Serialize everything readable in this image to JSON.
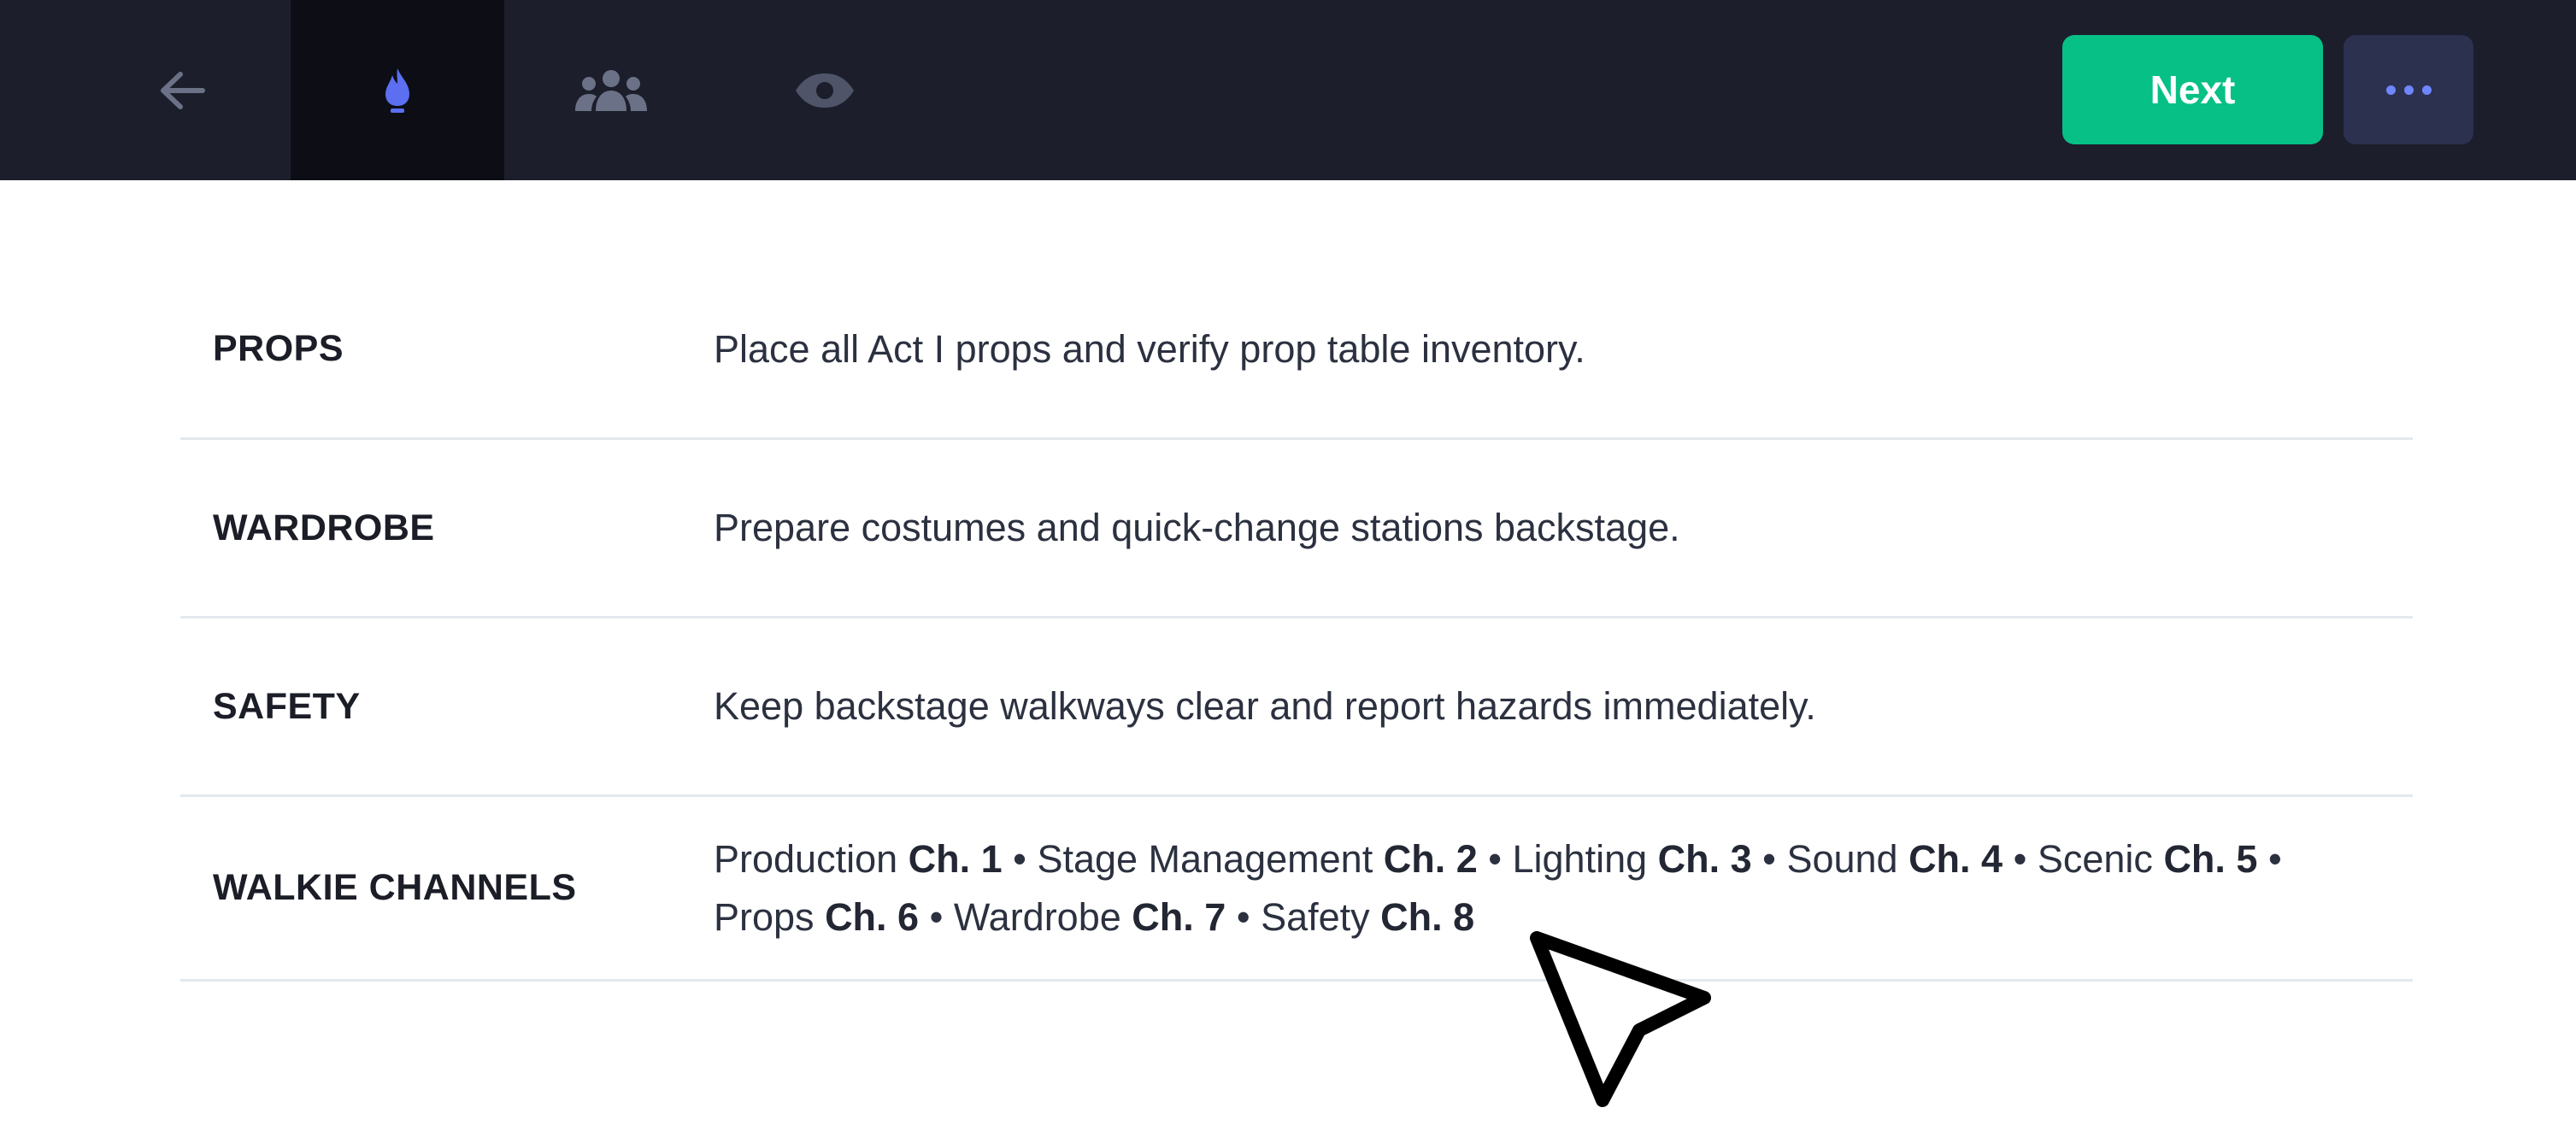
{
  "toolbar": {
    "tabs": [
      {
        "name": "back",
        "icon": "arrow-left-icon",
        "active": false
      },
      {
        "name": "fire",
        "icon": "flame-icon",
        "active": true
      },
      {
        "name": "team",
        "icon": "users-icon",
        "active": false
      },
      {
        "name": "view",
        "icon": "eye-icon",
        "active": false
      }
    ],
    "next_label": "Next",
    "more_icon": "ellipsis-icon"
  },
  "rows": [
    {
      "label": "PROPS",
      "description": "Place all Act I props and verify prop table inventory."
    },
    {
      "label": "WARDROBE",
      "description": "Prepare costumes and quick-change stations backstage."
    },
    {
      "label": "SAFETY",
      "description": "Keep backstage walkways clear and report hazards immediately."
    }
  ],
  "walkie": {
    "label": "WALKIE CHANNELS",
    "channels": [
      {
        "dept": "Production",
        "channel": "Ch. 1"
      },
      {
        "dept": "Stage Management",
        "channel": "Ch. 2"
      },
      {
        "dept": "Lighting",
        "channel": "Ch. 3"
      },
      {
        "dept": "Sound",
        "channel": "Ch. 4"
      },
      {
        "dept": "Scenic",
        "channel": "Ch. 5"
      },
      {
        "dept": "Props",
        "channel": "Ch. 6"
      },
      {
        "dept": "Wardrobe",
        "channel": "Ch. 7"
      },
      {
        "dept": "Safety",
        "channel": "Ch. 8"
      }
    ],
    "separator": " • "
  },
  "colors": {
    "topbar": "#1c1e2b",
    "active_tab": "#0d0e15",
    "next_button": "#06c086",
    "more_button": "#2d3150",
    "accent": "#6f86ff"
  }
}
